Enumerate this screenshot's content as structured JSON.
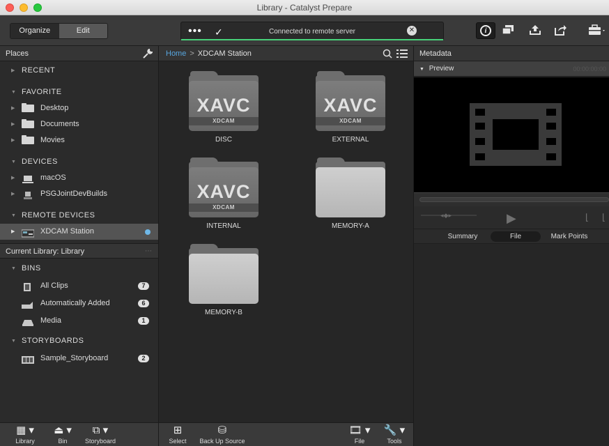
{
  "window": {
    "title": "Library - Catalyst Prepare"
  },
  "toolbar": {
    "organize_label": "Organize",
    "edit_label": "Edit",
    "status_message": "Connected to remote server",
    "status_dots": "•••",
    "status_check": "✓",
    "status_close": "✕",
    "progress_color": "#48d27a"
  },
  "places": {
    "header": "Places",
    "sections": {
      "recent": "RECENT",
      "favorite": "FAVORITE",
      "devices": "DEVICES",
      "remote": "REMOTE DEVICES"
    },
    "favorites": [
      "Desktop",
      "Documents",
      "Movies"
    ],
    "devices": [
      "macOS",
      "PSGJointDevBuilds"
    ],
    "remote_devices": [
      "XDCAM Station"
    ]
  },
  "library": {
    "label": "Current Library: Library",
    "grip": "⋯",
    "bins_header": "BINS",
    "bins": [
      {
        "name": "All Clips",
        "count": "7"
      },
      {
        "name": "Automatically Added",
        "count": "6"
      },
      {
        "name": "Media",
        "count": "1"
      }
    ],
    "storyboards_header": "STORYBOARDS",
    "storyboards": [
      {
        "name": "Sample_Storyboard",
        "count": "2"
      }
    ]
  },
  "left_bottom": {
    "library": "Library",
    "bin": "Bin",
    "storyboard": "Storyboard"
  },
  "breadcrumb": {
    "home": "Home",
    "separator": ">",
    "current": "XDCAM Station"
  },
  "folders": [
    {
      "name": "DISC",
      "badge": "XAVC",
      "sub": "XDCAM"
    },
    {
      "name": "EXTERNAL",
      "badge": "XAVC",
      "sub": "XDCAM"
    },
    {
      "name": "INTERNAL",
      "badge": "XAVC",
      "sub": "XDCAM"
    },
    {
      "name": "MEMORY-A"
    },
    {
      "name": "MEMORY-B"
    }
  ],
  "center_bottom": {
    "select": "Select",
    "backup": "Back Up Source",
    "file": "File",
    "tools": "Tools"
  },
  "metadata": {
    "header": "Metadata",
    "preview_label": "Preview",
    "timecode": "00:00:00:00",
    "tabs": [
      "Summary",
      "File",
      "Mark Points"
    ],
    "active_tab": "File"
  }
}
